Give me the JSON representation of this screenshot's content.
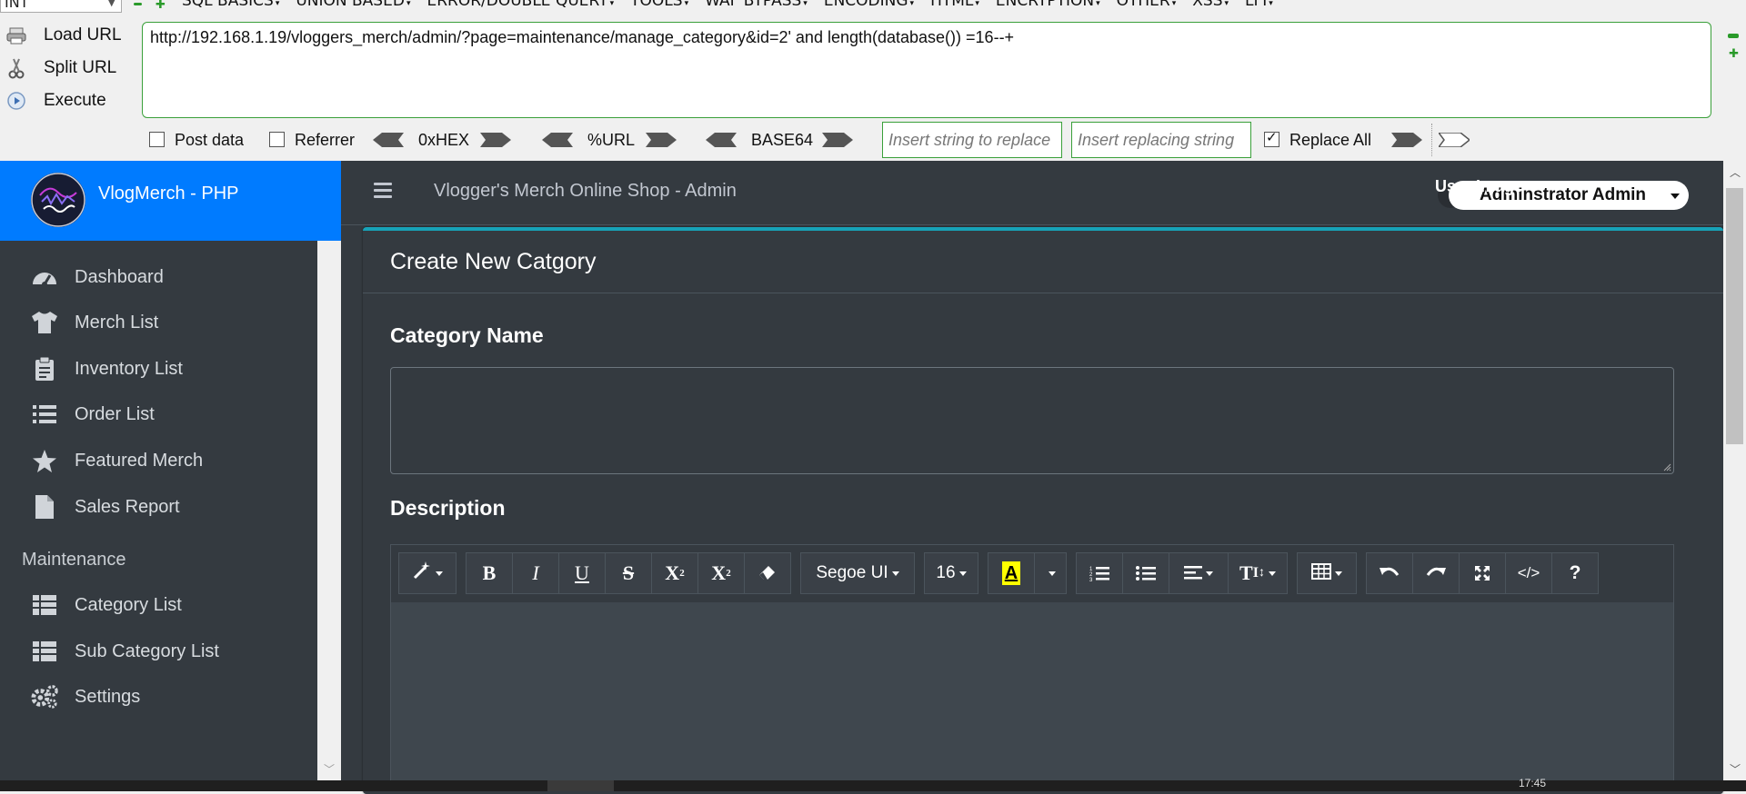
{
  "hackbar": {
    "type_value": "INT",
    "menu": [
      "SQL BASICS",
      "UNION BASED",
      "ERROR/DOUBLE QUERY",
      "TOOLS",
      "WAF BYPASS",
      "ENCODING",
      "HTML",
      "ENCRYPTION",
      "OTHER",
      "XSS",
      "LFI"
    ],
    "load_url": "Load URL",
    "split_url": "Split URL",
    "execute": "Execute",
    "url": "http://192.168.1.19/vloggers_merch/admin/?page=maintenance/manage_category&id=2' and length(database()) =16--+",
    "post_data": "Post data",
    "referrer": "Referrer",
    "hex": "0xHEX",
    "urlenc": "%URL",
    "base64": "BASE64",
    "replace_placeholder": "Insert string to replace",
    "replacing_placeholder": "Insert replacing string",
    "replace_all": "Replace All",
    "replace_all_checked": true
  },
  "brand": {
    "name": "VlogMerch - PHP"
  },
  "sidebar": {
    "items": [
      {
        "label": "Dashboard",
        "icon": "dashboard-icon"
      },
      {
        "label": "Merch List",
        "icon": "tshirt-icon"
      },
      {
        "label": "Inventory List",
        "icon": "clipboard-icon"
      },
      {
        "label": "Order List",
        "icon": "list-icon"
      },
      {
        "label": "Featured Merch",
        "icon": "star-icon"
      },
      {
        "label": "Sales Report",
        "icon": "file-icon"
      }
    ],
    "section": "Maintenance",
    "maintenance_items": [
      {
        "label": "Category List",
        "icon": "table-icon"
      },
      {
        "label": "Sub Category List",
        "icon": "table-icon"
      },
      {
        "label": "Settings",
        "icon": "gears-icon"
      }
    ]
  },
  "topnav": {
    "title": "Vlogger's Merch Online Shop - Admin",
    "user_image_alt": "User Image",
    "user_name": "Adminstrator Admin"
  },
  "card": {
    "title": "Create New Catgory",
    "category_label": "Category Name",
    "description_label": "Description"
  },
  "editor": {
    "font_name": "Segoe UI",
    "font_size": "16",
    "highlight_color": "#ffff00"
  },
  "taskbar": {
    "clock": "17:45"
  },
  "colors": {
    "brand_bg": "#007bff",
    "card_accent": "#17a2b8",
    "dark_bg": "#343a40",
    "hackbar_border": "#3aa03a"
  }
}
